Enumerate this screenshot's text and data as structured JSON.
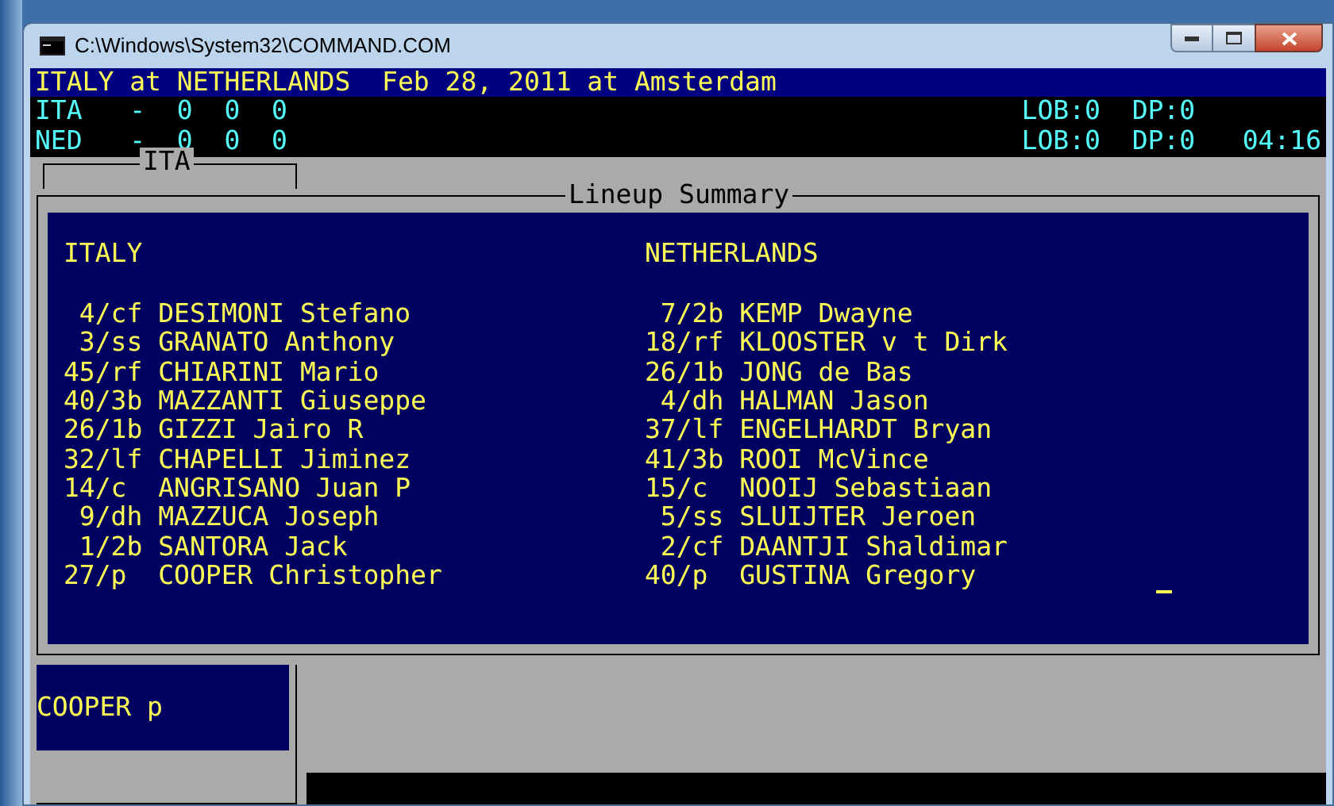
{
  "window": {
    "title": "C:\\Windows\\System32\\COMMAND.COM"
  },
  "header": {
    "title": "ITALY at NETHERLANDS  Feb 28, 2011 at Amsterdam"
  },
  "scoreboard": [
    {
      "team": "ITA",
      "dash": "-",
      "scores": [
        "0",
        "0",
        "0"
      ],
      "lob": "LOB:0",
      "dp": "DP:0"
    },
    {
      "team": "NED",
      "dash": "-",
      "scores": [
        "0",
        "0",
        "0"
      ],
      "lob": "LOB:0",
      "dp": "DP:0",
      "clock": "04:16"
    }
  ],
  "tab": {
    "label": "ITA"
  },
  "lineup": {
    "title": "Lineup Summary",
    "teams": [
      {
        "name": "ITALY",
        "players": [
          {
            "spot": "4/cf",
            "name": "DESIMONI Stefano"
          },
          {
            "spot": "3/ss",
            "name": "GRANATO Anthony"
          },
          {
            "spot": "45/rf",
            "name": "CHIARINI Mario"
          },
          {
            "spot": "40/3b",
            "name": "MAZZANTI Giuseppe"
          },
          {
            "spot": "26/1b",
            "name": "GIZZI Jairo R"
          },
          {
            "spot": "32/lf",
            "name": "CHAPELLI Jiminez"
          },
          {
            "spot": "14/c",
            "name": "ANGRISANO Juan P"
          },
          {
            "spot": "9/dh",
            "name": "MAZZUCA Joseph"
          },
          {
            "spot": "1/2b",
            "name": "SANTORA Jack"
          },
          {
            "spot": "27/p",
            "name": "COOPER Christopher"
          }
        ]
      },
      {
        "name": "NETHERLANDS",
        "players": [
          {
            "spot": "7/2b",
            "name": "KEMP Dwayne"
          },
          {
            "spot": "18/rf",
            "name": "KLOOSTER v t Dirk"
          },
          {
            "spot": "26/1b",
            "name": "JONG de Bas"
          },
          {
            "spot": "4/dh",
            "name": "HALMAN Jason"
          },
          {
            "spot": "37/lf",
            "name": "ENGELHARDT Bryan"
          },
          {
            "spot": "41/3b",
            "name": "ROOI McVince"
          },
          {
            "spot": "15/c",
            "name": "NOOIJ Sebastiaan"
          },
          {
            "spot": "5/ss",
            "name": "SLUIJTER Jeroen"
          },
          {
            "spot": "2/cf",
            "name": "DAANTJI Shaldimar"
          },
          {
            "spot": "40/p",
            "name": "GUSTINA Gregory"
          }
        ]
      }
    ]
  },
  "current": {
    "text": "COOPER p"
  }
}
